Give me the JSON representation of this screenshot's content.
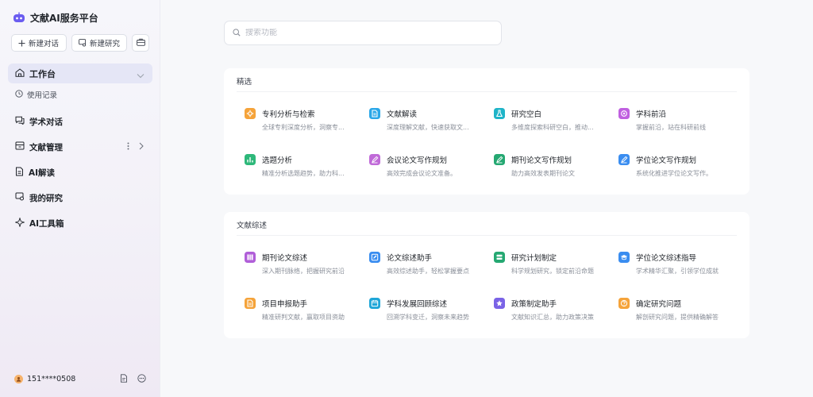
{
  "sidebar": {
    "title": "文献AI服务平台",
    "new_chat_label": "新建对话",
    "new_research_label": "新建研究",
    "active": {
      "label": "工作台"
    },
    "sub_item": {
      "label": "使用记录"
    },
    "items": [
      {
        "key": "chat",
        "label": "学术对话"
      },
      {
        "key": "docs",
        "label": "文献管理"
      },
      {
        "key": "ai-read",
        "label": "AI解读"
      },
      {
        "key": "research",
        "label": "我的研究"
      },
      {
        "key": "toolbox",
        "label": "AI工具箱"
      }
    ],
    "user": {
      "phone": "151****0508"
    }
  },
  "search": {
    "placeholder": "搜索功能"
  },
  "sections": [
    {
      "title": "精选",
      "tools": [
        {
          "name": "专利分析与检索",
          "desc": "全球专利深度分析，洞察专...",
          "color": "#f5a33a",
          "icon": "gear-icon"
        },
        {
          "name": "文献解读",
          "desc": "深度理解文献，快速获取文...",
          "color": "#2aa7e8",
          "icon": "document-icon"
        },
        {
          "name": "研究空白",
          "desc": "多维度探索科研空白，推动...",
          "color": "#1fb4c8",
          "icon": "flask-icon"
        },
        {
          "name": "学科前沿",
          "desc": "掌握前沿，站在科研前线",
          "color": "#c060e0",
          "icon": "target-icon"
        },
        {
          "name": "选题分析",
          "desc": "精准分析选题趋势，助力科...",
          "color": "#2eb87a",
          "icon": "chart-icon"
        },
        {
          "name": "会议论文写作规划",
          "desc": "高效完成会议论文准备。",
          "color": "#c06ad8",
          "icon": "pen-icon"
        },
        {
          "name": "期刊论文写作规划",
          "desc": "助力高效发表期刊论文",
          "color": "#25a872",
          "icon": "pen-icon"
        },
        {
          "name": "学位论文写作规划",
          "desc": "系统化推进学位论文写作。",
          "color": "#3a8df0",
          "icon": "pen-icon"
        }
      ]
    },
    {
      "title": "文献综述",
      "tools": [
        {
          "name": "期刊论文综述",
          "desc": "深入期刊脉络，把握研究前沿",
          "color": "#b05ed8",
          "icon": "grid-icon"
        },
        {
          "name": "论文综述助手",
          "desc": "高效综述助手，轻松掌握要点",
          "color": "#3a8df0",
          "icon": "edit-icon"
        },
        {
          "name": "研究计划制定",
          "desc": "科学规划研究，锁定前沿命题",
          "color": "#25a872",
          "icon": "list-icon"
        },
        {
          "name": "学位论文综述指导",
          "desc": "学术精华汇聚，引领学位成就",
          "color": "#3a8df0",
          "icon": "graduation-cap-icon"
        },
        {
          "name": "项目申报助手",
          "desc": "精准研判文献，赢取项目资助",
          "color": "#f5a33a",
          "icon": "document-icon"
        },
        {
          "name": "学科发展回顾综述",
          "desc": "回溯学科变迁，洞察未来趋势",
          "color": "#1fa6d8",
          "icon": "calendar-icon"
        },
        {
          "name": "政策制定助手",
          "desc": "文献知识汇总，助力政策决策",
          "color": "#7a63e6",
          "icon": "star-icon"
        },
        {
          "name": "确定研究问题",
          "desc": "解剖研究问题，提供精确解答",
          "color": "#f5a33a",
          "icon": "question-icon"
        }
      ]
    }
  ]
}
